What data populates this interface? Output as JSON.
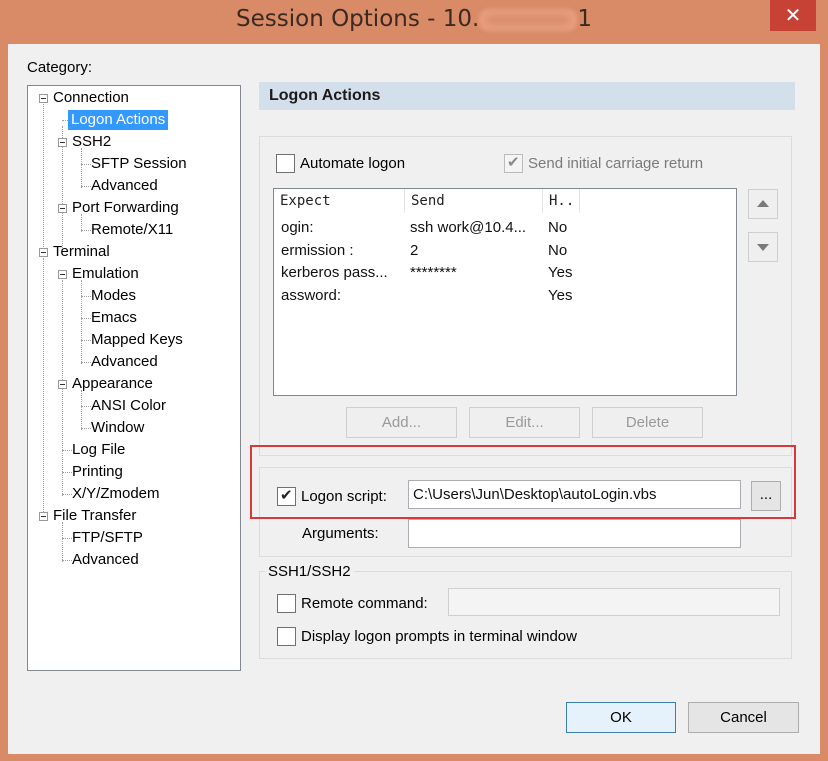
{
  "window": {
    "title_prefix": "Session Options - 10.",
    "title_suffix": "1",
    "close_glyph": "✕"
  },
  "category_label": "Category:",
  "tree": {
    "connection": "Connection",
    "logon_actions": "Logon Actions",
    "ssh2": "SSH2",
    "sftp_session": "SFTP Session",
    "ssh2_advanced": "Advanced",
    "port_forwarding": "Port Forwarding",
    "remote_x11": "Remote/X11",
    "terminal": "Terminal",
    "emulation": "Emulation",
    "modes": "Modes",
    "emacs": "Emacs",
    "mapped_keys": "Mapped Keys",
    "emulation_advanced": "Advanced",
    "appearance": "Appearance",
    "ansi_color": "ANSI Color",
    "window": "Window",
    "log_file": "Log File",
    "printing": "Printing",
    "xyzmodem": "X/Y/Zmodem",
    "file_transfer": "File Transfer",
    "ftp_sftp": "FTP/SFTP",
    "ft_advanced": "Advanced"
  },
  "panel": {
    "header": "Logon Actions",
    "automate_logon": {
      "label": "Automate logon",
      "checked": false
    },
    "send_cr": {
      "label": "Send initial carriage return",
      "checked": true,
      "disabled": true
    },
    "table": {
      "columns": [
        "Expect",
        "Send",
        "H.."
      ],
      "rows": [
        [
          "ogin:",
          "ssh work@10.4...",
          "No"
        ],
        [
          "ermission :",
          "2",
          "No"
        ],
        [
          "kerberos pass...",
          "********",
          "Yes"
        ],
        [
          "assword:",
          "",
          "Yes"
        ]
      ]
    },
    "add_button": "Add...",
    "edit_button": "Edit...",
    "delete_button": "Delete",
    "logon_script": {
      "label": "Logon script:",
      "checked": true,
      "value": "C:\\Users\\Jun\\Desktop\\autoLogin.vbs"
    },
    "browse_button": "...",
    "arguments_label": "Arguments:",
    "arguments_value": "",
    "ssh_group_label": "SSH1/SSH2",
    "remote_command": {
      "label": "Remote command:",
      "checked": false,
      "value": ""
    },
    "display_prompts": {
      "label": "Display logon prompts in terminal window",
      "checked": false
    }
  },
  "footer": {
    "ok": "OK",
    "cancel": "Cancel"
  },
  "colors": {
    "titlebar": "#d98a66",
    "close": "#c74135",
    "selection": "#3399ff",
    "highlight_box": "#d9383a"
  }
}
